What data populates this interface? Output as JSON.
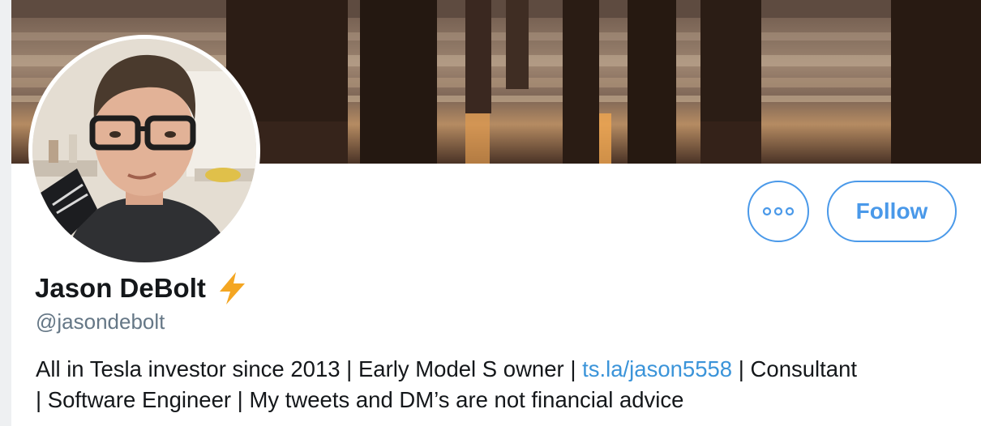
{
  "profile": {
    "display_name": "Jason DeBolt",
    "name_emoji": "lightning-bolt-icon",
    "handle": "@jasondebolt",
    "bio": {
      "line1_before_link": "All in Tesla investor since 2013 | Early Model S owner | ",
      "link_text": "ts.la/jason5558",
      "line1_after_link": " | Consultant",
      "line2": "| Software Engineer | My tweets and DM’s are not financial advice"
    }
  },
  "actions": {
    "more_icon": "more-dots-icon",
    "follow_label": "Follow"
  },
  "colors": {
    "accent": "#4a99e9",
    "link": "#3b94d9",
    "text_primary": "#14171a",
    "text_secondary": "#657786",
    "bolt": "#f4a622"
  }
}
